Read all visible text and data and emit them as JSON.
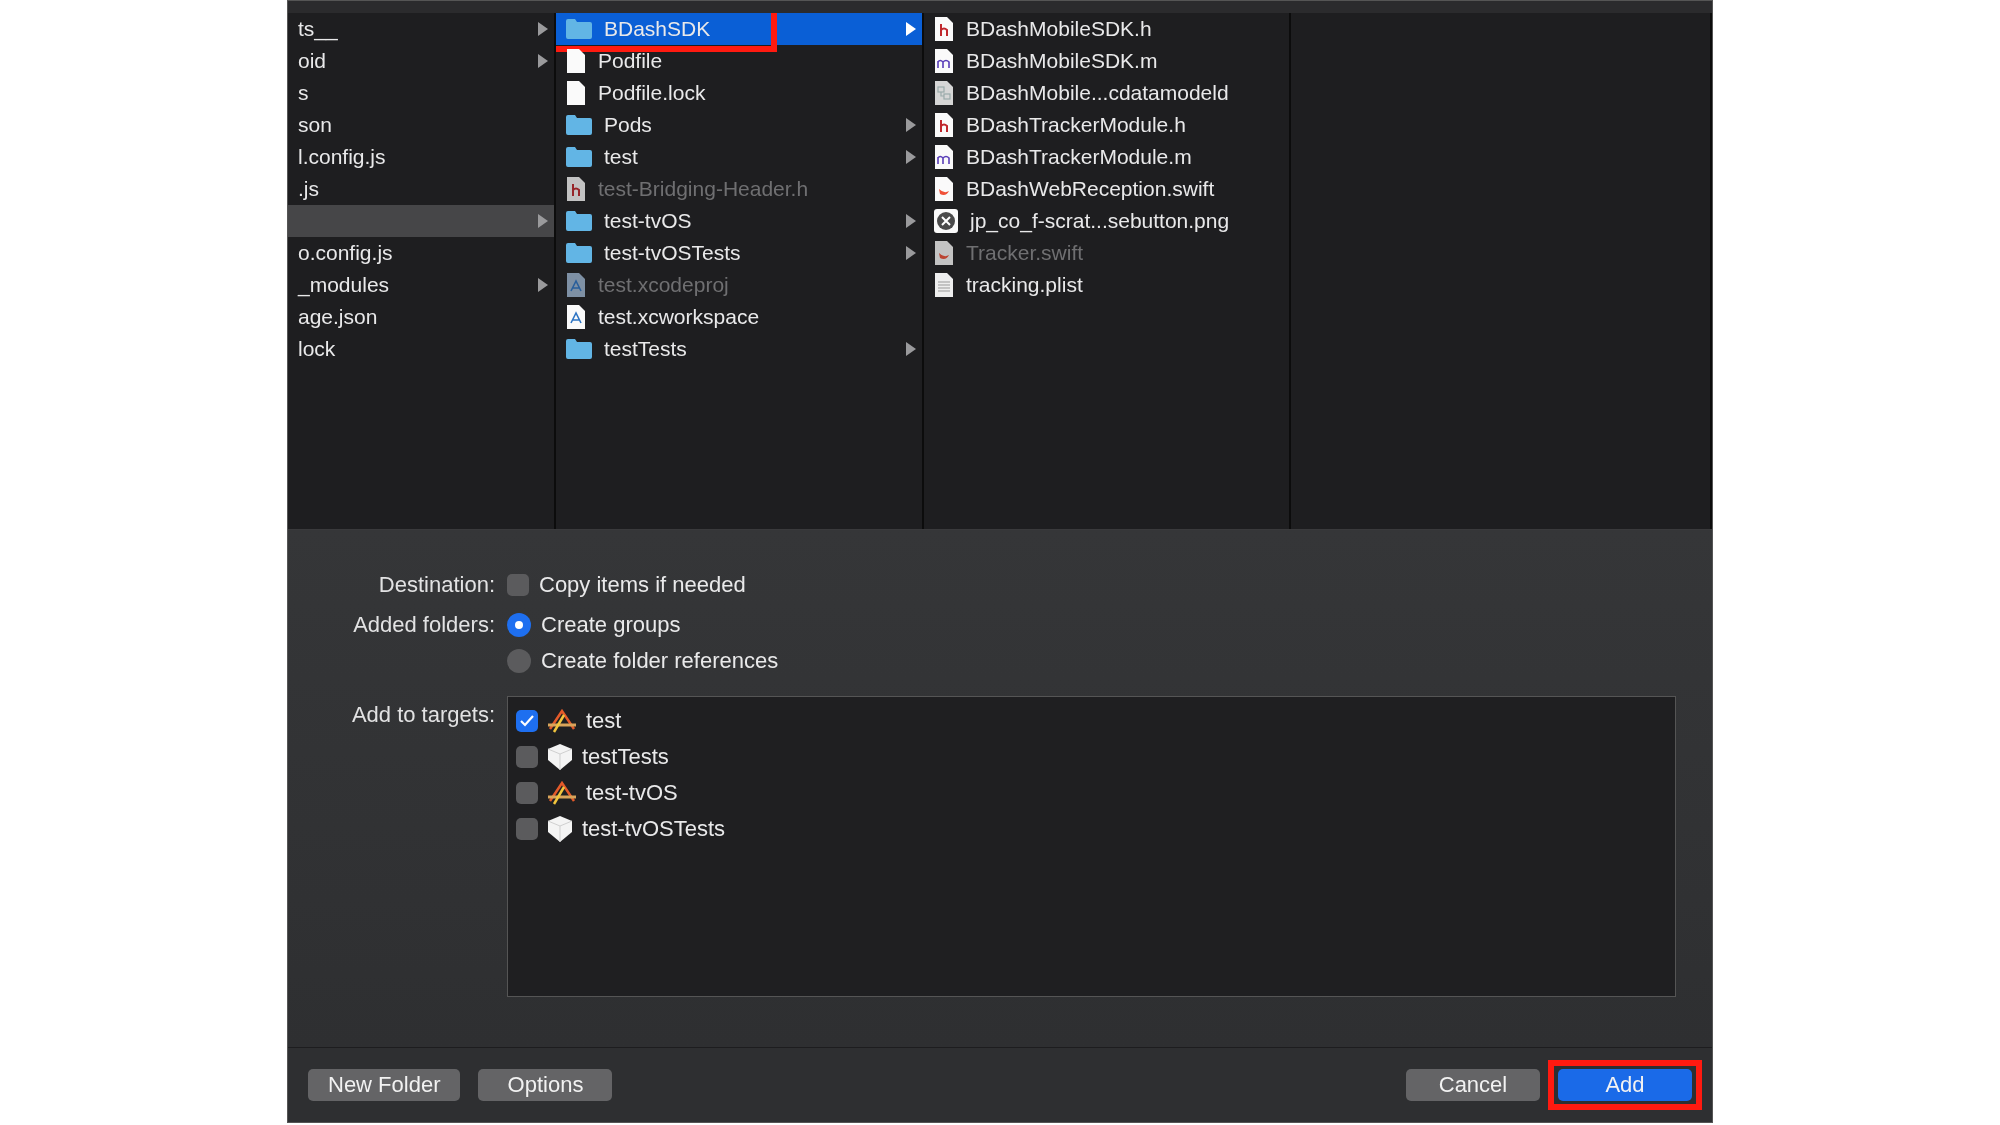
{
  "browser": {
    "columns": [
      {
        "items": [
          {
            "name": "ts__",
            "kind": "none",
            "has_children": true,
            "dimmed": false,
            "selected": false
          },
          {
            "name": "oid",
            "kind": "none",
            "has_children": true,
            "dimmed": false,
            "selected": false
          },
          {
            "name": "s",
            "kind": "none",
            "has_children": false,
            "dimmed": false,
            "selected": false
          },
          {
            "name": "son",
            "kind": "none",
            "has_children": false,
            "dimmed": false,
            "selected": false
          },
          {
            "name": "l.config.js",
            "kind": "none",
            "has_children": false,
            "dimmed": false,
            "selected": false
          },
          {
            "name": ".js",
            "kind": "none",
            "has_children": false,
            "dimmed": false,
            "selected": false
          },
          {
            "kind": "none",
            "has_children": true,
            "dimmed": false,
            "selected": true
          },
          {
            "name": "o.config.js",
            "kind": "none",
            "has_children": false,
            "dimmed": false,
            "selected": false
          },
          {
            "name": "_modules",
            "kind": "none",
            "has_children": true,
            "dimmed": false,
            "selected": false
          },
          {
            "name": "age.json",
            "kind": "none",
            "has_children": false,
            "dimmed": false,
            "selected": false
          },
          {
            "name": "lock",
            "kind": "none",
            "has_children": false,
            "dimmed": false,
            "selected": false
          }
        ]
      },
      {
        "items": [
          {
            "name": "BDashSDK",
            "kind": "folder",
            "has_children": true,
            "dimmed": false,
            "selected": true,
            "annotated": true
          },
          {
            "name": "Podfile",
            "kind": "doc",
            "has_children": false,
            "dimmed": false,
            "selected": false
          },
          {
            "name": "Podfile.lock",
            "kind": "doc",
            "has_children": false,
            "dimmed": false,
            "selected": false
          },
          {
            "name": "Pods",
            "kind": "folder",
            "has_children": true,
            "dimmed": false,
            "selected": false
          },
          {
            "name": "test",
            "kind": "folder",
            "has_children": true,
            "dimmed": false,
            "selected": false
          },
          {
            "name": "test-Bridging-Header.h",
            "kind": "header",
            "has_children": false,
            "dimmed": true,
            "selected": false
          },
          {
            "name": "test-tvOS",
            "kind": "folder",
            "has_children": true,
            "dimmed": false,
            "selected": false
          },
          {
            "name": "test-tvOSTests",
            "kind": "folder",
            "has_children": true,
            "dimmed": false,
            "selected": false
          },
          {
            "name": "test.xcodeproj",
            "kind": "xcodeproj",
            "has_children": false,
            "dimmed": true,
            "selected": false
          },
          {
            "name": "test.xcworkspace",
            "kind": "workspace",
            "has_children": false,
            "dimmed": false,
            "selected": false
          },
          {
            "name": "testTests",
            "kind": "folder",
            "has_children": true,
            "dimmed": false,
            "selected": false
          }
        ]
      },
      {
        "items": [
          {
            "name": "BDashMobileSDK.h",
            "kind": "header",
            "has_children": false,
            "dimmed": false,
            "selected": false
          },
          {
            "name": "BDashMobileSDK.m",
            "kind": "impl",
            "has_children": false,
            "dimmed": false,
            "selected": false
          },
          {
            "name": "BDashMobile...cdatamodeld",
            "kind": "datamodel",
            "has_children": false,
            "dimmed": false,
            "selected": false
          },
          {
            "name": "BDashTrackerModule.h",
            "kind": "header",
            "has_children": false,
            "dimmed": false,
            "selected": false
          },
          {
            "name": "BDashTrackerModule.m",
            "kind": "impl",
            "has_children": false,
            "dimmed": false,
            "selected": false
          },
          {
            "name": "BDashWebReception.swift",
            "kind": "swift",
            "has_children": false,
            "dimmed": false,
            "selected": false
          },
          {
            "name": "jp_co_f-scrat...sebutton.png",
            "kind": "image",
            "has_children": false,
            "dimmed": false,
            "selected": false
          },
          {
            "name": "Tracker.swift",
            "kind": "swift",
            "has_children": false,
            "dimmed": true,
            "selected": false
          },
          {
            "name": "tracking.plist",
            "kind": "plist",
            "has_children": false,
            "dimmed": false,
            "selected": false
          }
        ]
      }
    ]
  },
  "options": {
    "destination": {
      "label": "Destination:",
      "checkbox": {
        "label": "Copy items if needed",
        "checked": false
      }
    },
    "added_folders": {
      "label": "Added folders:",
      "radios": [
        {
          "label": "Create groups",
          "selected": true
        },
        {
          "label": "Create folder references",
          "selected": false
        }
      ]
    },
    "targets": {
      "label": "Add to targets:",
      "items": [
        {
          "name": "test",
          "kind": "app",
          "checked": true
        },
        {
          "name": "testTests",
          "kind": "test",
          "checked": false
        },
        {
          "name": "test-tvOS",
          "kind": "app",
          "checked": false
        },
        {
          "name": "test-tvOSTests",
          "kind": "test",
          "checked": false
        }
      ]
    }
  },
  "buttons": {
    "left": [
      {
        "label": "New Folder",
        "primary": false
      },
      {
        "label": "Options",
        "primary": false
      }
    ],
    "right": [
      {
        "label": "Cancel",
        "primary": false
      },
      {
        "label": "Add",
        "primary": true,
        "annotated": true
      }
    ]
  }
}
